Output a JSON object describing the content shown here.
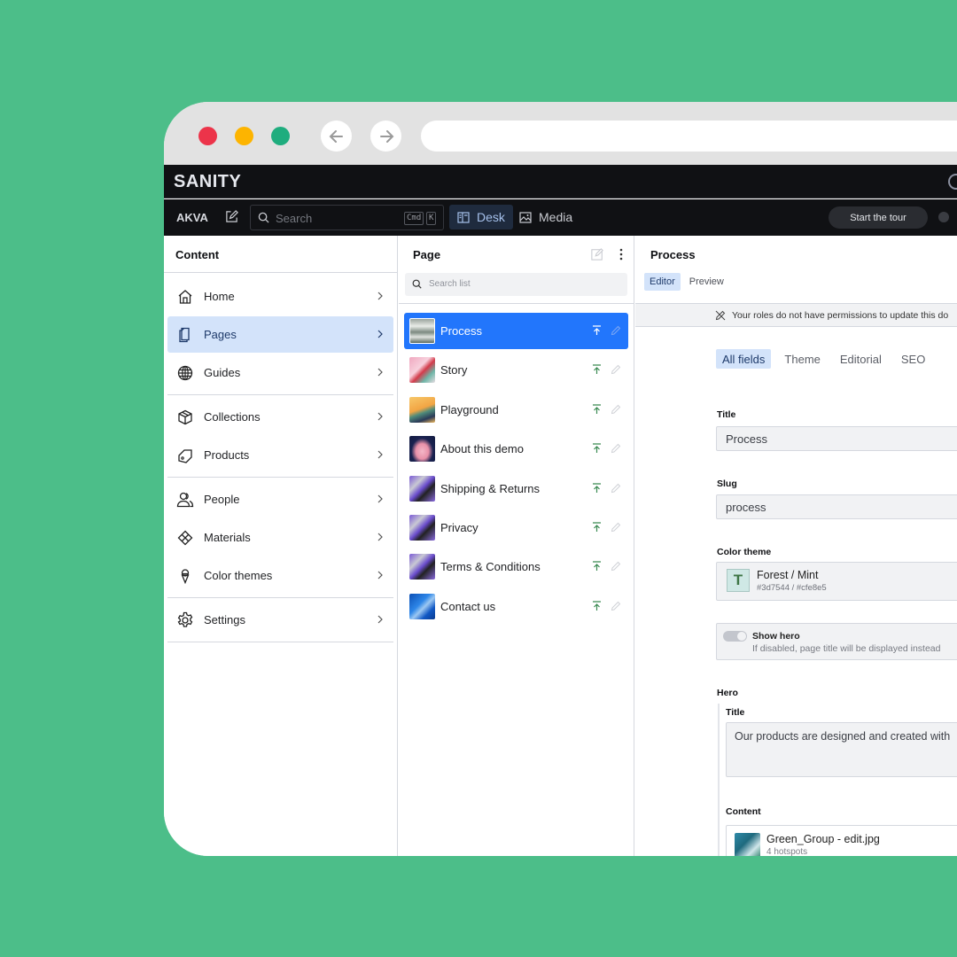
{
  "browser": {
    "back_label": "Back",
    "forward_label": "Forward"
  },
  "topbar": {
    "logo": "SANITY"
  },
  "toolbar": {
    "workspace": "AKVA",
    "search_placeholder": "Search",
    "kbd_cmd": "Cmd",
    "kbd_k": "K",
    "desk_label": "Desk",
    "media_label": "Media",
    "tour_label": "Start the tour"
  },
  "content_pane": {
    "title": "Content",
    "items": [
      {
        "label": "Home",
        "icon": "home-icon"
      },
      {
        "label": "Pages",
        "icon": "pages-icon",
        "active": true
      },
      {
        "label": "Guides",
        "icon": "globe-icon"
      },
      {
        "label": "Collections",
        "icon": "box-icon"
      },
      {
        "label": "Products",
        "icon": "tag-icon"
      },
      {
        "label": "People",
        "icon": "users-icon"
      },
      {
        "label": "Materials",
        "icon": "diamond-icon"
      },
      {
        "label": "Color themes",
        "icon": "icecream-icon"
      },
      {
        "label": "Settings",
        "icon": "gear-icon"
      }
    ]
  },
  "list_pane": {
    "title": "Page",
    "search_placeholder": "Search list",
    "items": [
      {
        "label": "Process",
        "active": true
      },
      {
        "label": "Story"
      },
      {
        "label": "Playground"
      },
      {
        "label": "About this demo"
      },
      {
        "label": "Shipping & Returns"
      },
      {
        "label": "Privacy"
      },
      {
        "label": "Terms & Conditions"
      },
      {
        "label": "Contact us"
      }
    ]
  },
  "doc_pane": {
    "title": "Process",
    "tabs": {
      "editor": "Editor",
      "preview": "Preview"
    },
    "banner": "Your roles do not have permissions to update this do",
    "field_tabs": [
      "All fields",
      "Theme",
      "Editorial",
      "SEO"
    ],
    "fields": {
      "title_label": "Title",
      "title_value": "Process",
      "slug_label": "Slug",
      "slug_value": "process",
      "color_theme_label": "Color theme",
      "color_theme_name": "Forest / Mint",
      "color_theme_letter": "T",
      "color_theme_hex": "#3d7544 / #cfe8e5",
      "show_hero_label": "Show hero",
      "show_hero_desc": "If disabled, page title will be displayed instead",
      "show_hero_value": false,
      "hero_label": "Hero",
      "hero_title_label": "Title",
      "hero_title_value": "Our products are designed and created with",
      "hero_content_label": "Content",
      "hero_content_file": "Green_Group - edit.jpg",
      "hero_content_hotspots": "4 hotspots"
    }
  },
  "colors": {
    "background": "#4cbe89",
    "accent": "#2276fc",
    "publish_green": "#3a8a52",
    "theme_primary": "#3d7544",
    "theme_secondary": "#cfe8e5"
  }
}
